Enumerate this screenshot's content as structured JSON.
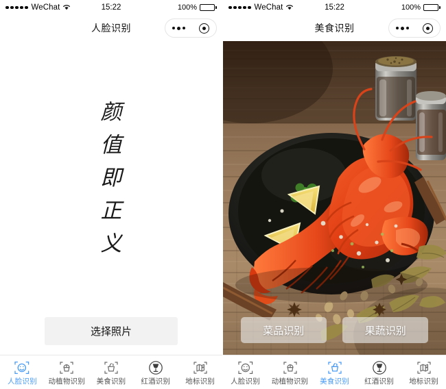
{
  "screens": [
    {
      "id": "face",
      "statusbar": {
        "carrier": "WeChat",
        "time": "15:22",
        "battery": "100%"
      },
      "nav_title": "人脸识别",
      "hero_text": [
        "颜",
        "值",
        "即",
        "正",
        "义"
      ],
      "primary_button": "选择照片",
      "active_tab_index": 0
    },
    {
      "id": "food",
      "statusbar": {
        "carrier": "WeChat",
        "time": "15:22",
        "battery": "100%"
      },
      "nav_title": "美食识别",
      "photo_alt": "烤龙虾配柠檬与香草摆盘，木质桌面上放有调味罐、八角、桂皮与月桂叶",
      "actions": [
        {
          "label": "菜品识别"
        },
        {
          "label": "果蔬识别"
        }
      ],
      "active_tab_index": 2
    }
  ],
  "tabs": [
    {
      "label": "人脸识别",
      "icon": "face-scan-icon"
    },
    {
      "label": "动植物识别",
      "icon": "plant-scan-icon"
    },
    {
      "label": "美食识别",
      "icon": "food-scan-icon"
    },
    {
      "label": "红酒识别",
      "icon": "wine-glass-icon"
    },
    {
      "label": "地标识别",
      "icon": "landmark-map-icon"
    }
  ],
  "colors": {
    "accent": "#4a9bf5",
    "tab_inactive": "#555555",
    "button_bg": "#f2f2f2",
    "glass_button_bg": "rgba(236,236,236,0.62)"
  },
  "capsule": {
    "more_icon": "more-dots-icon",
    "close_icon": "target-circle-icon"
  }
}
